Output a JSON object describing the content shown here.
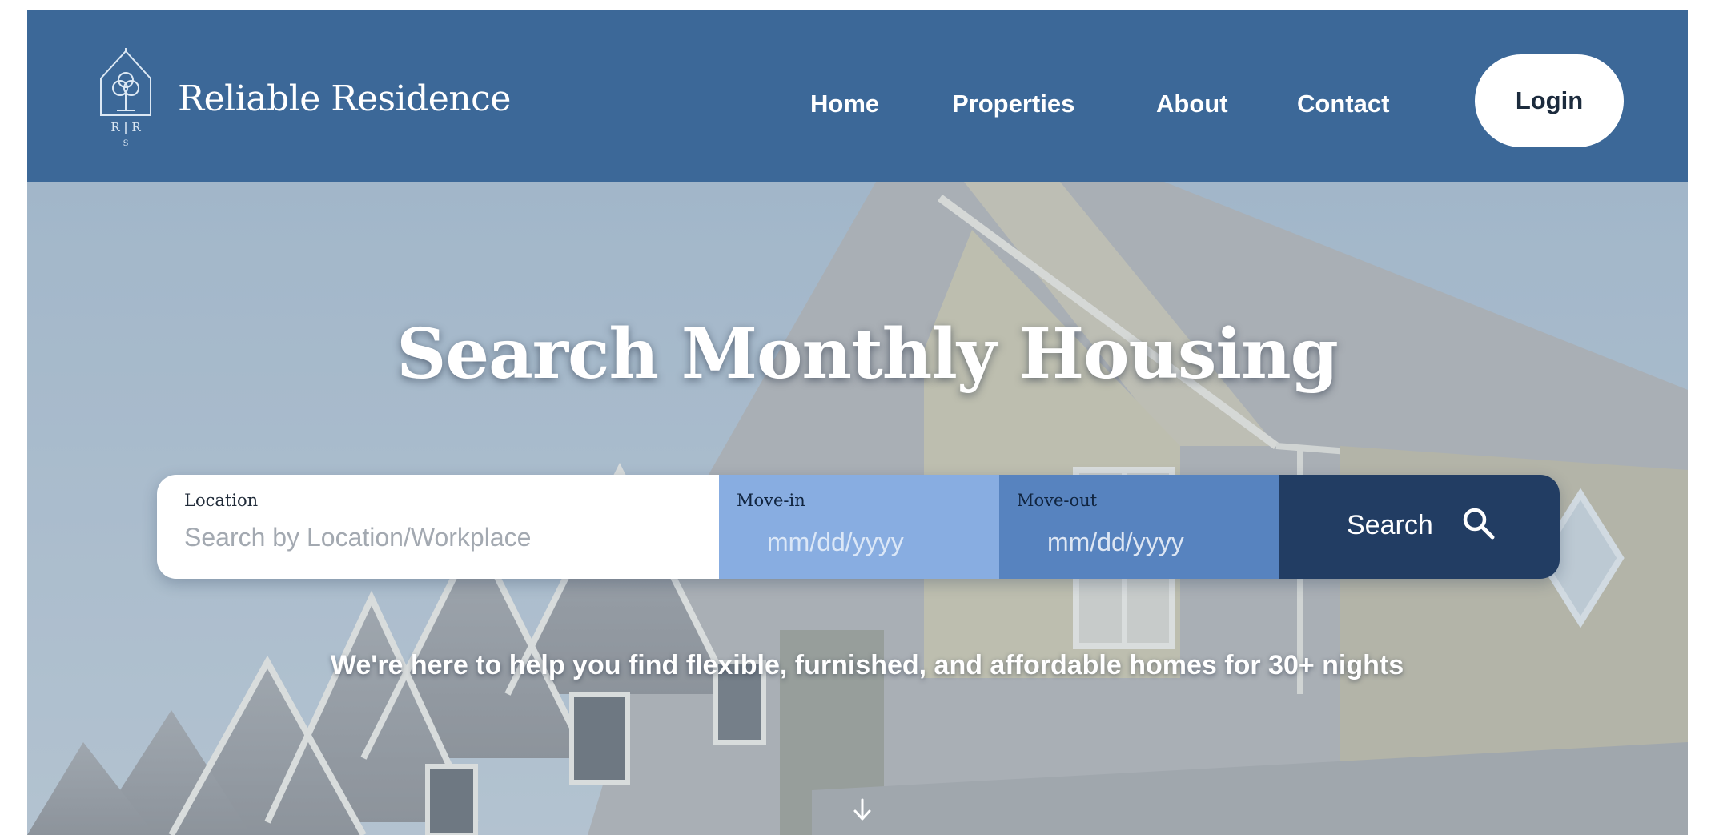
{
  "brand": {
    "name": "Reliable Residence",
    "monogram": "RR",
    "logo_icon": "house-logo-icon"
  },
  "nav": {
    "items": [
      {
        "label": "Home"
      },
      {
        "label": "Properties"
      },
      {
        "label": "About"
      },
      {
        "label": "Contact"
      }
    ],
    "login_label": "Login"
  },
  "hero": {
    "title": "Search Monthly Housing",
    "background": "house-photo",
    "tagline": "We're here to help you find flexible, furnished, and affordable homes for 30+ nights",
    "scroll_icon": "arrow-down-icon"
  },
  "search": {
    "location_label": "Location",
    "location_placeholder": "Search by Location/Workplace",
    "movein_label": "Move-in",
    "movein_placeholder": "mm/dd/yyyy",
    "moveout_label": "Move-out",
    "moveout_placeholder": "mm/dd/yyyy",
    "button_label": "Search",
    "button_icon": "search-icon"
  },
  "colors": {
    "header_bg": "#3c6898",
    "movein_bg": "#88ade1",
    "moveout_bg": "#5783bf",
    "search_button_bg": "#223d63",
    "login_bg": "#ffffff"
  }
}
